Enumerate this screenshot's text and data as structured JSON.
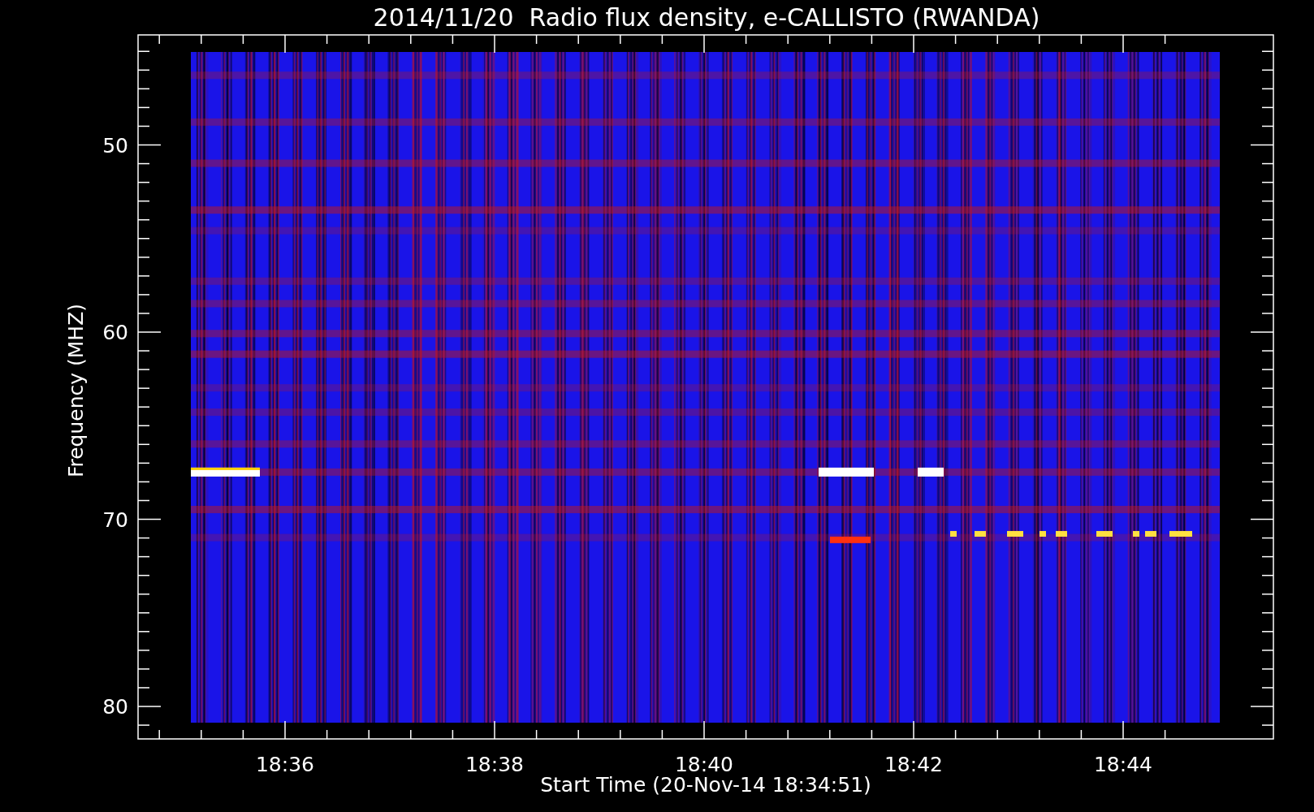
{
  "title": "2014/11/20  Radio flux density, e-CALLISTO (RWANDA)",
  "plot": {
    "ylabel": "Frequency (MHZ)",
    "xlabel": "Start Time (20-Nov-14 18:34:51)",
    "yticks": [
      "50",
      "60",
      "70",
      "80"
    ],
    "xticks": [
      "18:36",
      "18:38",
      "18:40",
      "18:42",
      "18:44"
    ]
  }
}
